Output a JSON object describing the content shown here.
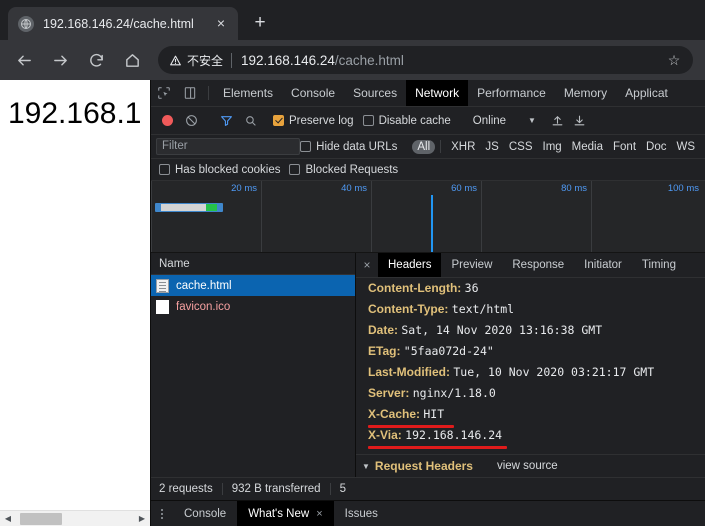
{
  "browser": {
    "tab": {
      "title": "192.168.146.24/cache.html",
      "favicon_icon": "globe-icon",
      "close_icon": "×",
      "newtab_label": "+"
    },
    "toolbar": {
      "back_icon": "arrow-left-icon",
      "forward_icon": "arrow-right-icon",
      "reload_icon": "reload-icon",
      "home_icon": "home-icon",
      "security_label": "不安全",
      "security_icon": "warning-triangle-icon",
      "url_host": "192.168.146.24",
      "url_path": "/cache.html",
      "url_full": "192.168.146.24/cache.html",
      "bookmark_icon": "☆"
    }
  },
  "page": {
    "body_text": "192.168.1",
    "scroll_left_arrow": "◀",
    "scroll_right_arrow": "▶"
  },
  "devtools": {
    "inspect_icon": "cursor-inspect-icon",
    "device_icon": "device-toggle-icon",
    "panels": [
      {
        "label": "Elements",
        "active": false
      },
      {
        "label": "Console",
        "active": false
      },
      {
        "label": "Sources",
        "active": false
      },
      {
        "label": "Network",
        "active": true
      },
      {
        "label": "Performance",
        "active": false
      },
      {
        "label": "Memory",
        "active": false
      },
      {
        "label": "Applicat",
        "active": false
      }
    ],
    "network_toolbar": {
      "record_icon": "record-dot-icon",
      "record_color": "#f05a5a",
      "clear_icon": "clear-icon",
      "filter_icon": "funnel-icon",
      "filter_icon_color": "#4f9af5",
      "search_icon": "search-icon",
      "preserve_log_label": "Preserve log",
      "preserve_log_checked": true,
      "disable_cache_label": "Disable cache",
      "disable_cache_checked": false,
      "throttle_value": "Online",
      "throttle_caret": "▼",
      "upload_icon": "upload-arrow-icon",
      "download_icon": "download-arrow-icon"
    },
    "filter_bar": {
      "filter_placeholder": "Filter",
      "hide_data_urls_label": "Hide data URLs",
      "hide_data_urls_checked": false,
      "types": [
        {
          "label": "All",
          "selected": true
        },
        {
          "label": "XHR",
          "selected": false
        },
        {
          "label": "JS",
          "selected": false
        },
        {
          "label": "CSS",
          "selected": false
        },
        {
          "label": "Img",
          "selected": false
        },
        {
          "label": "Media",
          "selected": false
        },
        {
          "label": "Font",
          "selected": false
        },
        {
          "label": "Doc",
          "selected": false
        },
        {
          "label": "WS",
          "selected": false
        }
      ]
    },
    "check_row": {
      "has_blocked_cookies_label": "Has blocked cookies",
      "has_blocked_cookies_checked": false,
      "blocked_requests_label": "Blocked Requests",
      "blocked_requests_checked": false
    },
    "overview": {
      "ticks": [
        "20 ms",
        "40 ms",
        "60 ms",
        "80 ms",
        "100 ms"
      ],
      "playhead_label": "60 ms"
    },
    "requests": {
      "column_name": "Name",
      "rows": [
        {
          "name": "cache.html",
          "icon": "document-icon",
          "selected": true,
          "error": false
        },
        {
          "name": "favicon.ico",
          "icon": "blank-file-icon",
          "selected": false,
          "error": true
        }
      ]
    },
    "detail": {
      "close_icon": "×",
      "tabs": [
        {
          "label": "Headers",
          "active": true
        },
        {
          "label": "Preview",
          "active": false
        },
        {
          "label": "Response",
          "active": false
        },
        {
          "label": "Initiator",
          "active": false
        },
        {
          "label": "Timing",
          "active": false
        }
      ],
      "headers": [
        {
          "key": "Content-Length:",
          "value": "36",
          "underline": false
        },
        {
          "key": "Content-Type:",
          "value": "text/html",
          "underline": false
        },
        {
          "key": "Date:",
          "value": "Sat, 14 Nov 2020 13:16:38 GMT",
          "underline": false
        },
        {
          "key": "ETag:",
          "value": "\"5faa072d-24\"",
          "underline": false
        },
        {
          "key": "Last-Modified:",
          "value": "Tue, 10 Nov 2020 03:21:17 GMT",
          "underline": false
        },
        {
          "key": "Server:",
          "value": "nginx/1.18.0",
          "underline": false
        },
        {
          "key": "X-Cache:",
          "value": "HIT",
          "underline": true
        },
        {
          "key": "X-Via:",
          "value": "192.168.146.24",
          "underline": true
        }
      ],
      "request_headers_title": "Request Headers",
      "request_headers_caret": "▼",
      "view_source_label": "view source"
    },
    "status_bar": {
      "requests": "2 requests",
      "transferred": "932 B transferred",
      "third_truncated": "5"
    },
    "drawer": {
      "kebab_icon": "more-vertical-icon",
      "tabs": [
        {
          "label": "Console",
          "active": false,
          "closable": false
        },
        {
          "label": "What's New",
          "active": true,
          "closable": true
        },
        {
          "label": "Issues",
          "active": false,
          "closable": false
        }
      ],
      "close_icon": "×"
    }
  },
  "colors": {
    "accent_blue": "#4f9af5",
    "record_red": "#f05a5a",
    "annotation_red": "#e01b1b",
    "selection_blue": "#0b64b0",
    "header_key": "#e0c07a",
    "error_text": "#f5a0a0"
  }
}
